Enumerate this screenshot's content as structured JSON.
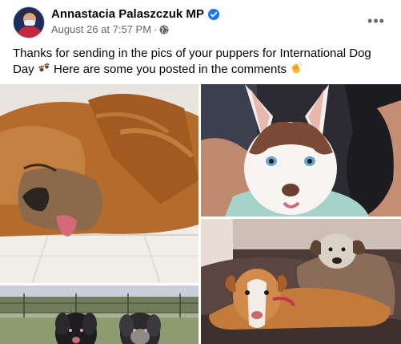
{
  "post": {
    "author": "Annastacia Palaszczuk MP",
    "date": "August 26 at 7:57 PM",
    "separator": "·",
    "text_main": "Thanks for sending in the pics of your puppers for International Dog Day",
    "text_tail": "Here are some you posted in the comments",
    "more_label": "•••"
  },
  "icons": {
    "verified": "verified-badge-icon",
    "audience": "globe-icon",
    "paw": "paw-prints-emoji",
    "clap": "clapping-hands-emoji"
  },
  "colors": {
    "verified_blue": "#1877f2",
    "meta_gray": "#65676b",
    "text_dark": "#050505"
  },
  "photos": [
    {
      "name": "sleeping-dog-photo"
    },
    {
      "name": "husky-puppy-photo"
    },
    {
      "name": "two-dogs-on-couch-photo"
    },
    {
      "name": "two-black-dogs-photo"
    }
  ]
}
